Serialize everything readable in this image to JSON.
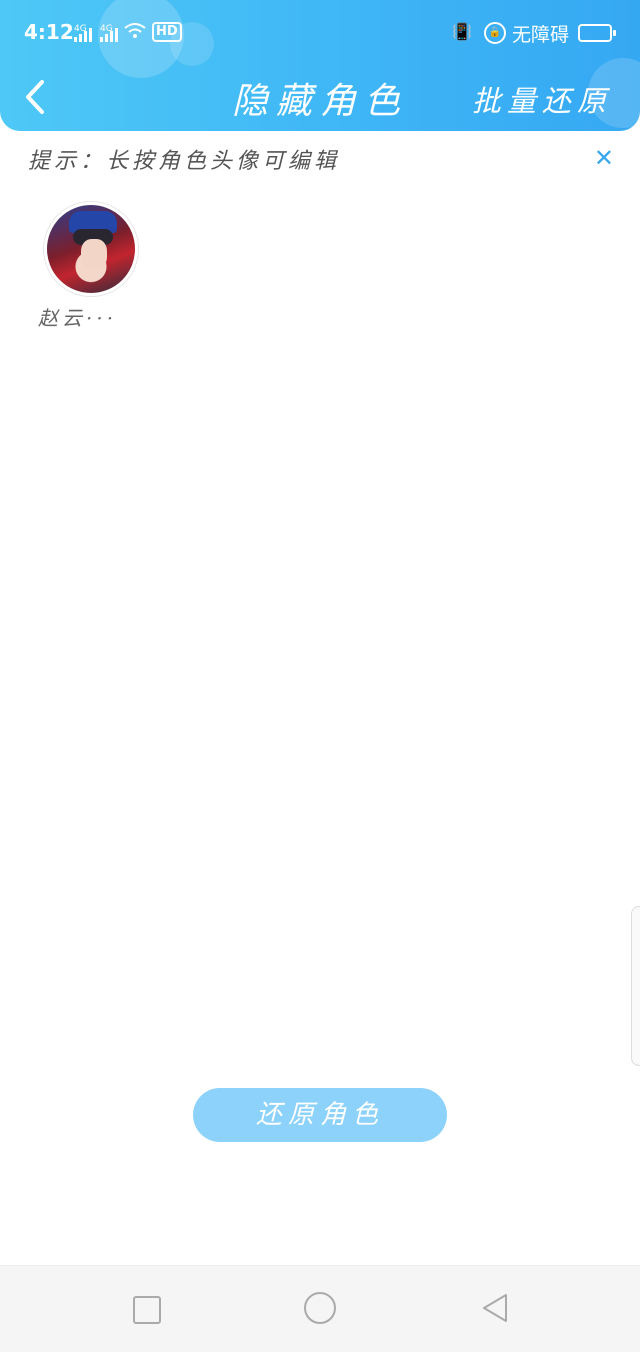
{
  "status_bar": {
    "time": "4:12",
    "net1": "4G",
    "net2": "4G",
    "hd": "HD",
    "accessibility": "无障碍"
  },
  "header": {
    "title": "隐藏角色",
    "batch_restore": "批量还原"
  },
  "hint": {
    "text": "提示：长按角色头像可编辑",
    "close": "✕"
  },
  "roles": [
    {
      "name": "赵云···"
    }
  ],
  "restore_button": "还原角色",
  "colors": {
    "header": "#3fb6f6",
    "accent": "#3aa8ec",
    "button": "#8dd2fb"
  },
  "icons": [
    "back-arrow-icon",
    "close-icon",
    "nav-recent-icon",
    "nav-home-icon",
    "nav-back-icon"
  ]
}
